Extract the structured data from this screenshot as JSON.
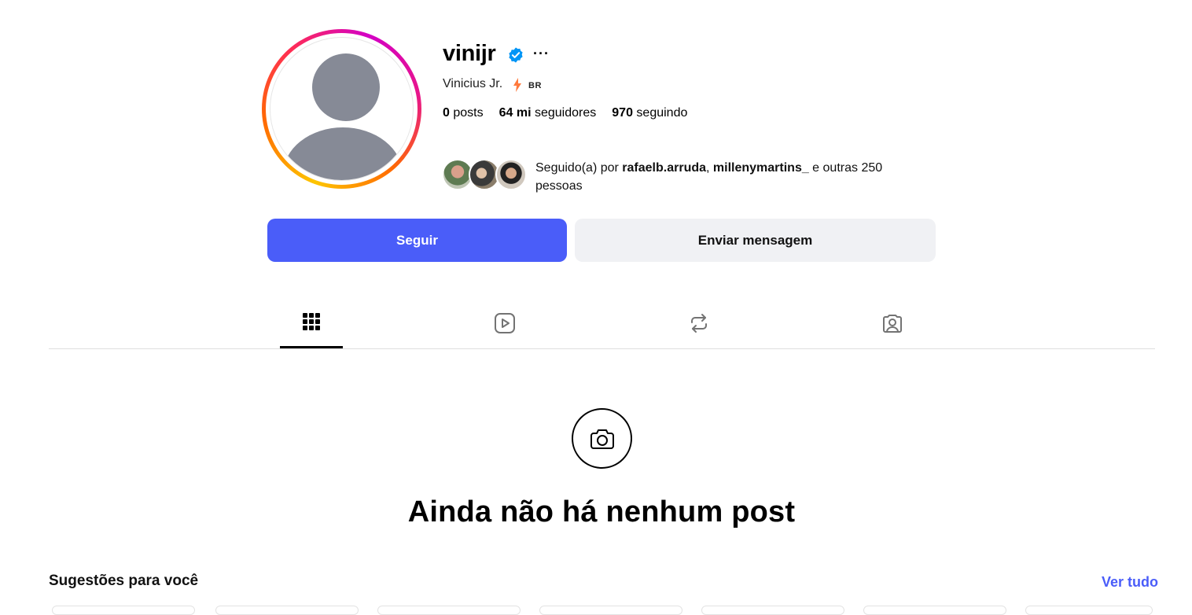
{
  "profile": {
    "username": "vinijr",
    "more_label": "···",
    "full_name": "Vinicius Jr.",
    "country_code": "BR",
    "stats": {
      "posts_count": "0",
      "posts_label": "posts",
      "followers_count": "64 mi",
      "followers_label": "seguidores",
      "following_count": "970",
      "following_label": "seguindo"
    },
    "followed_by": {
      "prefix": "Seguido(a) por ",
      "user1": "rafaelb.arruda",
      "separator": ", ",
      "user2": "millenymartins_",
      "suffix": " e outras 250 pessoas"
    }
  },
  "actions": {
    "follow_label": "Seguir",
    "message_label": "Enviar mensagem"
  },
  "tabs": [
    {
      "name": "grid-icon",
      "active": true
    },
    {
      "name": "reels-icon",
      "active": false
    },
    {
      "name": "reposts-icon",
      "active": false
    },
    {
      "name": "tagged-icon",
      "active": false
    }
  ],
  "empty_state": {
    "icon": "camera-icon",
    "title": "Ainda não há nenhum post"
  },
  "suggestions": {
    "title": "Sugestões para você",
    "see_all": "Ver tudo"
  },
  "colors": {
    "accent": "#4a5df9",
    "verified": "#0095f6",
    "secondary_button": "#f0f1f4"
  }
}
